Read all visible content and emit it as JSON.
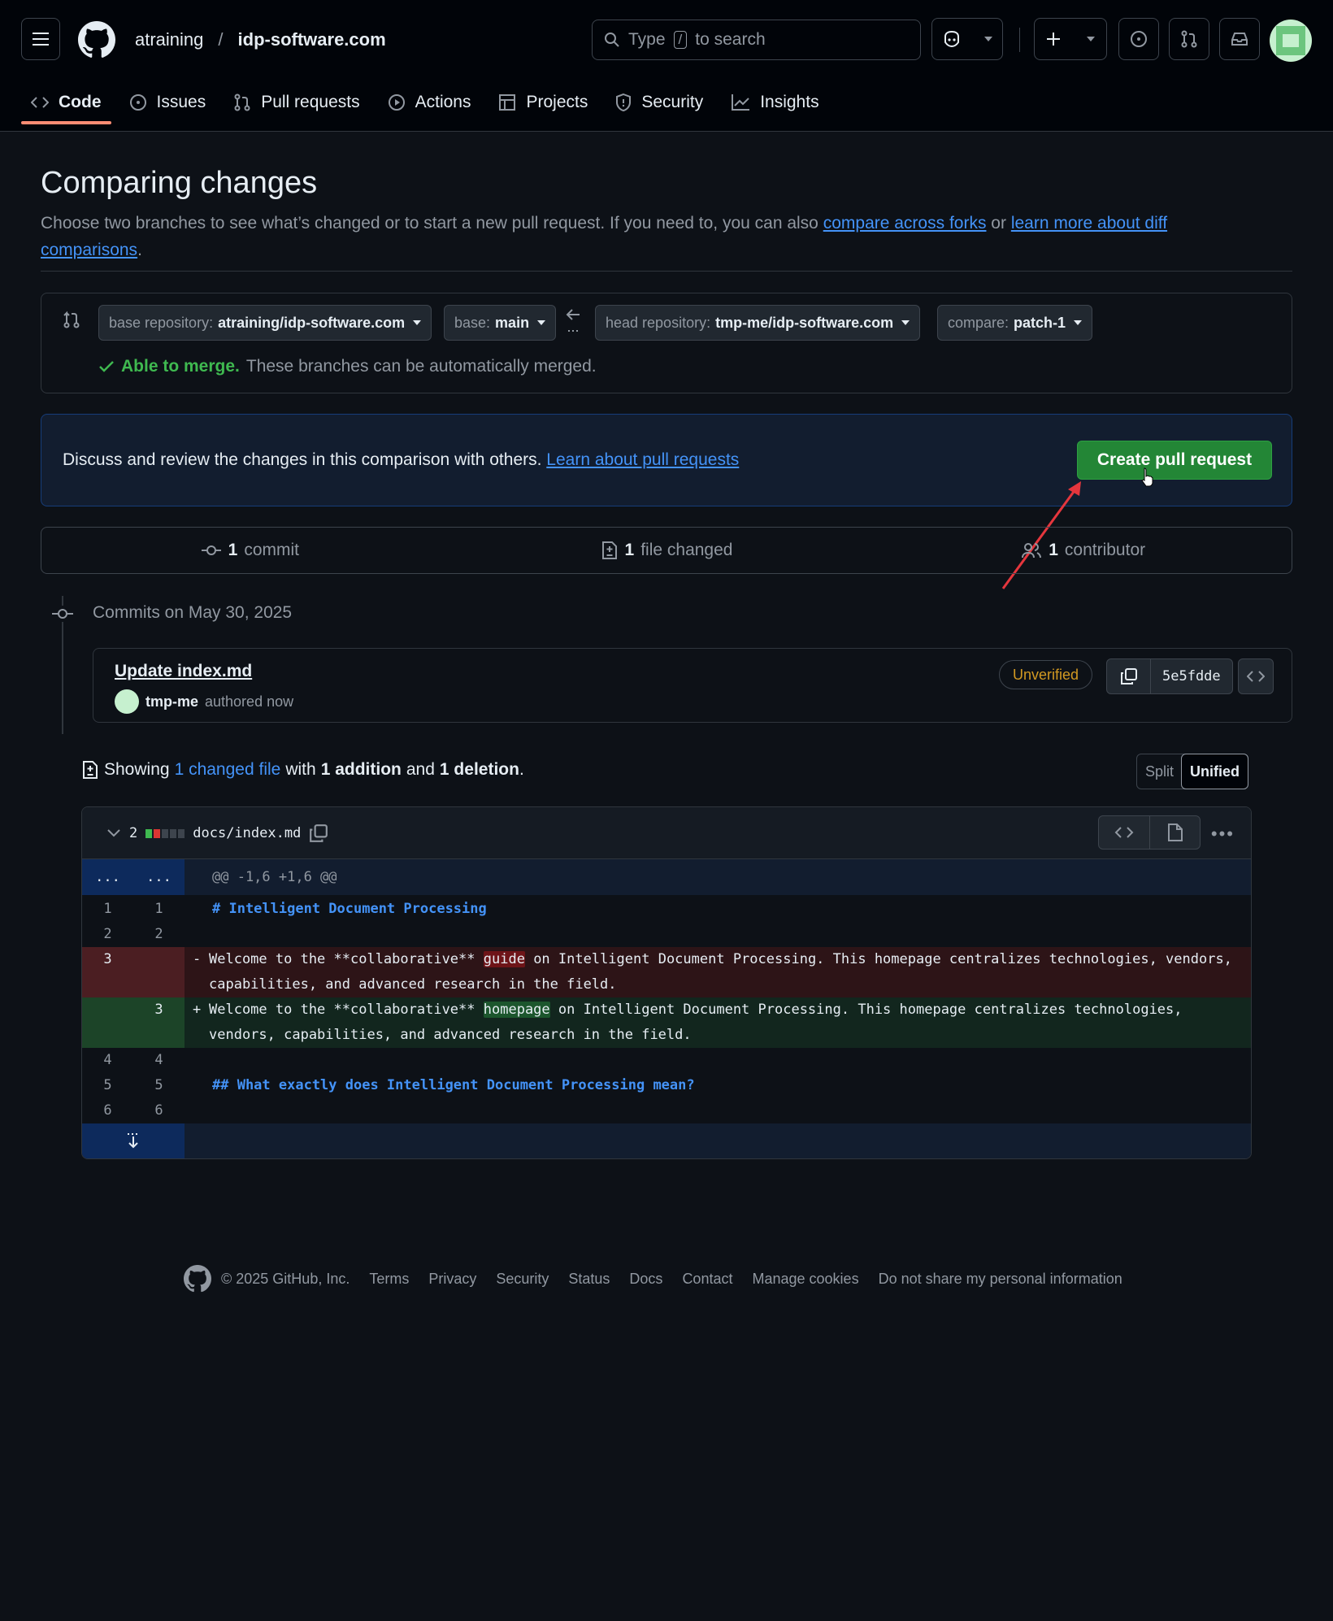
{
  "header": {
    "owner": "atraining",
    "separator": "/",
    "repo": "idp-software.com",
    "search": {
      "prefix": "Type",
      "key": "/",
      "suffix": "to search"
    }
  },
  "tabs": [
    {
      "label": "Code",
      "icon": "code-icon"
    },
    {
      "label": "Issues",
      "icon": "issue-icon"
    },
    {
      "label": "Pull requests",
      "icon": "pull-request-icon"
    },
    {
      "label": "Actions",
      "icon": "play-icon"
    },
    {
      "label": "Projects",
      "icon": "table-icon"
    },
    {
      "label": "Security",
      "icon": "shield-icon"
    },
    {
      "label": "Insights",
      "icon": "graph-icon"
    }
  ],
  "page": {
    "title": "Comparing changes",
    "subtitle_text": "Choose two branches to see what’s changed or to start a new pull request. If you need to, you can also",
    "link_forks": "compare across forks",
    "or": "or",
    "link_learn": "learn more about diff comparisons",
    "period": "."
  },
  "range": {
    "base_repo_label": "base repository:",
    "base_repo": "atraining/idp-software.com",
    "base_label": "base:",
    "base": "main",
    "head_repo_label": "head repository:",
    "head_repo": "tmp-me/idp-software.com",
    "compare_label": "compare:",
    "compare": "patch-1",
    "merge_ok": "Able to merge.",
    "merge_text": "These branches can be automatically merged."
  },
  "discuss": {
    "text": "Discuss and review the changes in this comparison with others.",
    "link": "Learn about pull requests",
    "button": "Create pull request"
  },
  "stats": {
    "commits_count": "1",
    "commits_label": "commit",
    "files_count": "1",
    "files_label": "file changed",
    "contributors_count": "1",
    "contributors_label": "contributor"
  },
  "commits": {
    "date_label": "Commits on May 30, 2025",
    "title": "Update index.md",
    "author": "tmp-me",
    "authored": "authored now",
    "badge": "Unverified",
    "sha": "5e5fdde"
  },
  "summary": {
    "showing": "Showing",
    "changed": "1 changed file",
    "with": "with",
    "additions": "1 addition",
    "and": "and",
    "deletions": "1 deletion",
    "period": ".",
    "split": "Split",
    "unified": "Unified"
  },
  "diff": {
    "count": "2",
    "path": "docs/index.md",
    "hunk": "@@ -1,6 +1,6 @@",
    "hunk_dots_left": "...",
    "hunk_dots_right": "...",
    "line1": "# Intelligent Document Processing",
    "del_pre": "Welcome to the **collaborative** ",
    "del_word": "guide",
    "del_post": " on Intelligent Document Processing. This homepage centralizes technologies, vendors, capabilities, and advanced research in the field.",
    "add_pre": "Welcome to the **collaborative** ",
    "add_word": "homepage",
    "add_post": " on Intelligent Document Processing. This homepage centralizes technologies, vendors, capabilities, and advanced research in the field.",
    "line5": "## What exactly does Intelligent Document Processing mean?",
    "ln": {
      "a1": "1",
      "b1": "1",
      "a2": "2",
      "b2": "2",
      "a3": "3",
      "b3": "3",
      "a4": "4",
      "b4": "4",
      "a5": "5",
      "b5": "5",
      "a6": "6",
      "b6": "6"
    },
    "minus": "-",
    "plus": "+"
  },
  "footer": {
    "copyright": "© 2025 GitHub, Inc.",
    "links": [
      "Terms",
      "Privacy",
      "Security",
      "Status",
      "Docs",
      "Contact",
      "Manage cookies",
      "Do not share my personal information"
    ]
  },
  "colors": {
    "accent": "#4493f8",
    "create": "#238636",
    "underline_tab": "#fd8c73",
    "ok": "#3fb950",
    "warn": "#d29922"
  }
}
